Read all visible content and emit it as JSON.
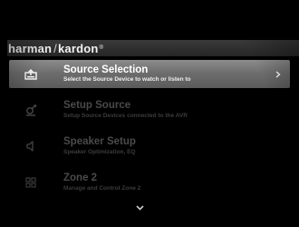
{
  "brand": {
    "part_a": "harman",
    "separator": "/",
    "part_b": "kardon",
    "registered": "®"
  },
  "menu": {
    "items": [
      {
        "title": "Source Selection",
        "subtitle": "Select the Source Device to watch or listen to",
        "icon": "source-input-icon",
        "selected": true
      },
      {
        "title": "Setup Source",
        "subtitle": "Setup Source Devices connected to the AVR",
        "icon": "setup-tools-icon",
        "selected": false
      },
      {
        "title": "Speaker Setup",
        "subtitle": "Speaker Optimization, EQ",
        "icon": "speaker-icon",
        "selected": false
      },
      {
        "title": "Zone 2",
        "subtitle": "Manage and Control Zone 2",
        "icon": "zone-grid-icon",
        "selected": false
      }
    ]
  },
  "colors": {
    "background": "#000000",
    "header_bar": "#2e2e2e",
    "selected_highlight": "#7a7a7a",
    "dim_text": "#4a4a4a",
    "active_text": "#ffffff"
  }
}
